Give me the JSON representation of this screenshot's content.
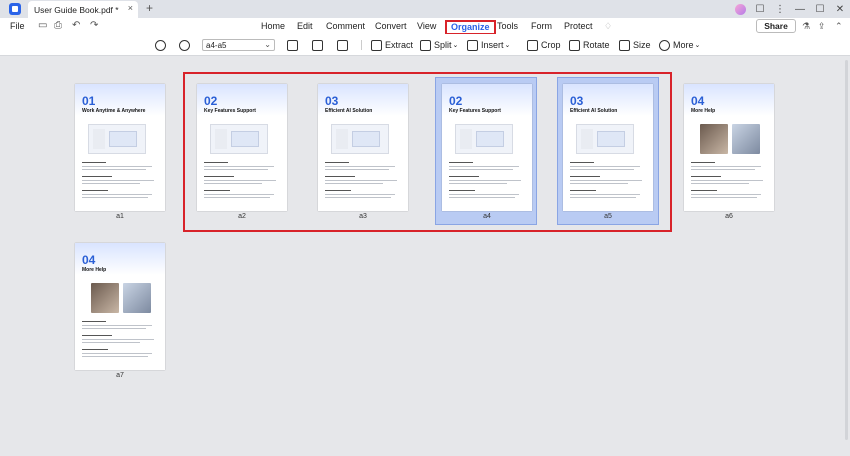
{
  "titlebar": {
    "tab_title": "User Guide Book.pdf *",
    "tab_close": "×",
    "tab_add": "+",
    "right_icons": [
      "☐",
      "⋮",
      "—",
      "☐",
      "✕"
    ]
  },
  "menubar": {
    "file": "File",
    "quick_actions": [
      "▭",
      "⎙",
      "↶",
      "↷"
    ],
    "tabs": [
      {
        "label": "Home",
        "active": false
      },
      {
        "label": "Edit",
        "active": false
      },
      {
        "label": "Comment",
        "active": false
      },
      {
        "label": "Convert",
        "active": false
      },
      {
        "label": "View",
        "active": false
      },
      {
        "label": "Organize",
        "active": true
      },
      {
        "label": "Tools",
        "active": false
      },
      {
        "label": "Form",
        "active": false
      },
      {
        "label": "Protect",
        "active": false
      }
    ],
    "share": "Share",
    "right_icons": [
      "⚗",
      "⇪",
      "⌃"
    ]
  },
  "toolbar": {
    "page_range": "a4-a5",
    "extract": "Extract",
    "split": "Split",
    "insert": "Insert",
    "crop": "Crop",
    "rotate": "Rotate",
    "size": "Size",
    "more": "More"
  },
  "pages": [
    {
      "label": "a1",
      "number": "01",
      "title": "Work Anytime & Anywhere",
      "selected": false,
      "kind": "shot"
    },
    {
      "label": "a2",
      "number": "02",
      "title": "Key Features Support",
      "selected": false,
      "kind": "shot"
    },
    {
      "label": "a3",
      "number": "03",
      "title": "Efficient AI Solution",
      "selected": false,
      "kind": "shot"
    },
    {
      "label": "a4",
      "number": "02",
      "title": "Key Features Support",
      "selected": true,
      "kind": "shot"
    },
    {
      "label": "a5",
      "number": "03",
      "title": "Efficient AI Solution",
      "selected": true,
      "kind": "shot"
    },
    {
      "label": "a6",
      "number": "04",
      "title": "More Help",
      "selected": false,
      "kind": "photos"
    },
    {
      "label": "a7",
      "number": "04",
      "title": "More Help",
      "selected": false,
      "kind": "photos"
    }
  ],
  "colors": {
    "accent": "#2a63e8",
    "selection_border": "#d8232a",
    "selected_bg": "#b9cbf3"
  }
}
